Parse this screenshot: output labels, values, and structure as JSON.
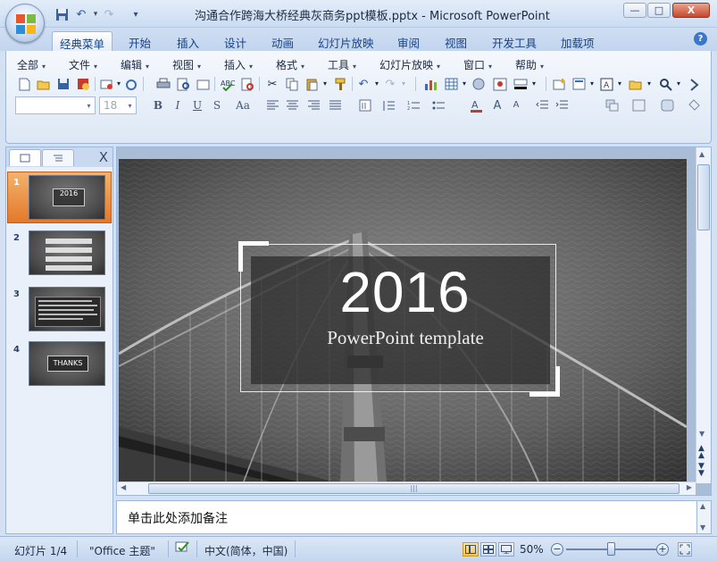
{
  "window": {
    "title": "沟通合作跨海大桥经典灰商务ppt模板.pptx - Microsoft PowerPoint",
    "controls": {
      "minimize": "—",
      "maximize": "□",
      "close": "X"
    }
  },
  "quick_access": {
    "save_icon": "save-icon",
    "undo_icon": "undo-icon",
    "redo_icon": "redo-icon",
    "customize": "▾"
  },
  "tabs": [
    "经典菜单",
    "开始",
    "插入",
    "设计",
    "动画",
    "幻灯片放映",
    "审阅",
    "视图",
    "开发工具",
    "加载项"
  ],
  "active_tab": "经典菜单",
  "classic_menu": [
    "全部",
    "文件",
    "编辑",
    "视图",
    "插入",
    "格式",
    "工具",
    "幻灯片放映",
    "窗口",
    "帮助"
  ],
  "font": {
    "name_value": "",
    "size_value": "18"
  },
  "format_buttons": {
    "bold": "B",
    "italic": "I",
    "underline": "U",
    "shadow": "S",
    "case": "Aa"
  },
  "pane": {
    "tab_slides_icon": "slide-icon",
    "tab_outline_icon": "outline-icon",
    "close": "X"
  },
  "thumbnails": [
    {
      "num": "1",
      "label": "2016",
      "selected": true
    },
    {
      "num": "2",
      "label": "",
      "selected": false
    },
    {
      "num": "3",
      "label": "",
      "selected": false
    },
    {
      "num": "4",
      "label": "THANKS",
      "selected": false
    }
  ],
  "slide": {
    "year": "2016",
    "subtitle": "PowerPoint template"
  },
  "notes": {
    "placeholder": "单击此处添加备注"
  },
  "status": {
    "slide_count": "幻灯片 1/4",
    "theme": "\"Office 主题\"",
    "language": "中文(简体，中国)",
    "zoom": "50%",
    "zoom_fraction": 0.5
  },
  "colors": {
    "accent": "#15428b",
    "selected_thumb": "#e98b35",
    "ribbon": "#dde8f6"
  }
}
